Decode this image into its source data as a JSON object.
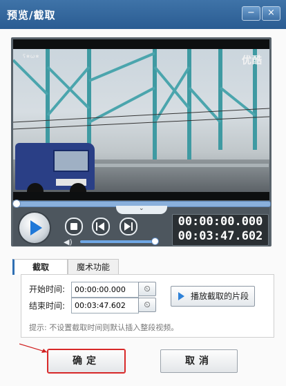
{
  "window": {
    "title": "预览/截取",
    "minimize_symbol": "−",
    "close_symbol": "×"
  },
  "video": {
    "watermark_logo": "优酷",
    "corner_text": "ʕ∗ω∗"
  },
  "player": {
    "seek_progress": 0.0,
    "volume_level": 1.0,
    "current_time": "00:00:00.000",
    "total_time": "00:03:47.602"
  },
  "tabs": [
    {
      "label": "截取",
      "active": true
    },
    {
      "label": "魔术功能",
      "active": false
    }
  ],
  "clip": {
    "start_label": "开始时间:",
    "start_value": "00:00:00.000",
    "end_label": "结束时间:",
    "end_value": "00:03:47.602",
    "play_segment_label": "播放截取的片段",
    "hint": "提示: 不设置截取时间则默认插入整段视频。"
  },
  "footer": {
    "ok_label": "确定",
    "cancel_label": "取消"
  },
  "colors": {
    "title_bar": "#2f6399",
    "accent": "#1f78d8",
    "highlight_border": "#d02020"
  },
  "icons": {
    "play": "play-icon",
    "stop": "stop-icon",
    "prev_frame": "prev-frame-icon",
    "next_frame": "next-frame-icon",
    "volume": "speaker-icon",
    "clock": "clock-icon"
  }
}
